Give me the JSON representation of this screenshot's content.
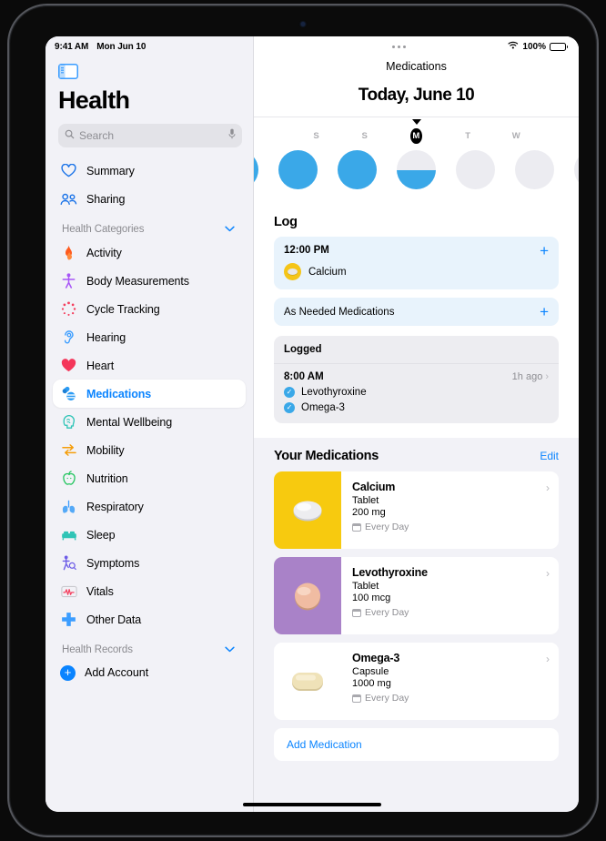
{
  "status_bar": {
    "time": "9:41 AM",
    "date": "Mon Jun 10",
    "battery_percent": "100%",
    "wifi_icon": "wifi-icon",
    "battery_icon": "battery-icon"
  },
  "sidebar": {
    "toggle_icon": "sidebar-toggle-icon",
    "title": "Health",
    "search": {
      "placeholder": "Search",
      "search_icon": "search-icon",
      "mic_icon": "microphone-icon"
    },
    "top_items": [
      {
        "label": "Summary",
        "icon": "heart-outline-icon"
      },
      {
        "label": "Sharing",
        "icon": "people-icon"
      }
    ],
    "categories_header": {
      "label": "Health Categories",
      "chevron": "chevron-down-icon"
    },
    "categories": [
      {
        "label": "Activity",
        "icon": "flame-icon",
        "color": "#ff6a2b"
      },
      {
        "label": "Body Measurements",
        "icon": "body-icon",
        "color": "#a855f7"
      },
      {
        "label": "Cycle Tracking",
        "icon": "cycle-icon",
        "color": "#f43f5e"
      },
      {
        "label": "Hearing",
        "icon": "ear-icon",
        "color": "#3b9dff"
      },
      {
        "label": "Heart",
        "icon": "heart-filled-icon",
        "color": "#f4365a"
      },
      {
        "label": "Medications",
        "icon": "pills-icon",
        "color": "#2b9bf4",
        "selected": true
      },
      {
        "label": "Mental Wellbeing",
        "icon": "brain-head-icon",
        "color": "#2ec4b6"
      },
      {
        "label": "Mobility",
        "icon": "arrows-icon",
        "color": "#f59e0b"
      },
      {
        "label": "Nutrition",
        "icon": "apple-icon",
        "color": "#22c55e"
      },
      {
        "label": "Respiratory",
        "icon": "lungs-icon",
        "color": "#3b9dff"
      },
      {
        "label": "Sleep",
        "icon": "bed-icon",
        "color": "#2ec4b6"
      },
      {
        "label": "Symptoms",
        "icon": "symptoms-icon",
        "color": "#6d5ce7"
      },
      {
        "label": "Vitals",
        "icon": "waveform-icon",
        "color": "#f43f5e"
      },
      {
        "label": "Other Data",
        "icon": "plus-cross-icon",
        "color": "#3b9dff"
      }
    ],
    "records_header": {
      "label": "Health Records",
      "chevron": "chevron-down-icon"
    },
    "add_account": {
      "label": "Add Account",
      "icon": "plus-circle-icon"
    }
  },
  "main": {
    "overflow_menu_icon": "more-options-icon",
    "nav_title": "Medications",
    "big_date": "Today, June 10",
    "date_strip": {
      "days": [
        {
          "letter": "",
          "state": "full",
          "edge": "left"
        },
        {
          "letter": "S",
          "state": "full"
        },
        {
          "letter": "S",
          "state": "full"
        },
        {
          "letter": "M",
          "state": "half",
          "today": true
        },
        {
          "letter": "T",
          "state": "empty"
        },
        {
          "letter": "W",
          "state": "empty"
        },
        {
          "letter": "",
          "state": "empty",
          "edge": "right"
        }
      ]
    },
    "log": {
      "heading": "Log",
      "scheduled": {
        "time": "12:00 PM",
        "add_label": "+",
        "medication": "Calcium",
        "pill_icon": "calcium-tablet-icon"
      },
      "as_needed": {
        "label": "As Needed Medications",
        "add_label": "+"
      },
      "logged": {
        "header": "Logged",
        "time": "8:00 AM",
        "ago": "1h ago",
        "chevron": "chevron-right-icon",
        "items": [
          {
            "name": "Levothyroxine",
            "check_icon": "checkmark-circle-icon"
          },
          {
            "name": "Omega-3",
            "check_icon": "checkmark-circle-icon"
          }
        ]
      }
    },
    "your_medications": {
      "heading": "Your Medications",
      "edit_label": "Edit",
      "items": [
        {
          "name": "Calcium",
          "form": "Tablet",
          "dose": "200 mg",
          "frequency": "Every Day",
          "thumb_bg": "#f7ca0f",
          "pill_shape": "oval",
          "pill_color": "#e9e9ec",
          "chevron": "chevron-right-icon",
          "calendar_icon": "calendar-icon"
        },
        {
          "name": "Levothyroxine",
          "form": "Tablet",
          "dose": "100 mcg",
          "frequency": "Every Day",
          "thumb_bg": "#a982c8",
          "pill_shape": "round",
          "pill_color": "#f0bca2",
          "chevron": "chevron-right-icon",
          "calendar_icon": "calendar-icon"
        },
        {
          "name": "Omega-3",
          "form": "Capsule",
          "dose": "1000 mg",
          "frequency": "Every Day",
          "thumb_bg": "#a5c council",
          "pill_shape": "capsule",
          "pill_color": "#efe2b8",
          "chevron": "chevron-right-icon",
          "calendar_icon": "calendar-icon"
        }
      ],
      "add_medication_label": "Add Medication"
    }
  },
  "colors": {
    "accent_blue": "#0a84ff",
    "log_card_blue": "#e8f3fc",
    "ring_blue": "#3aa8e8",
    "omega_green": "#a5c council"
  }
}
